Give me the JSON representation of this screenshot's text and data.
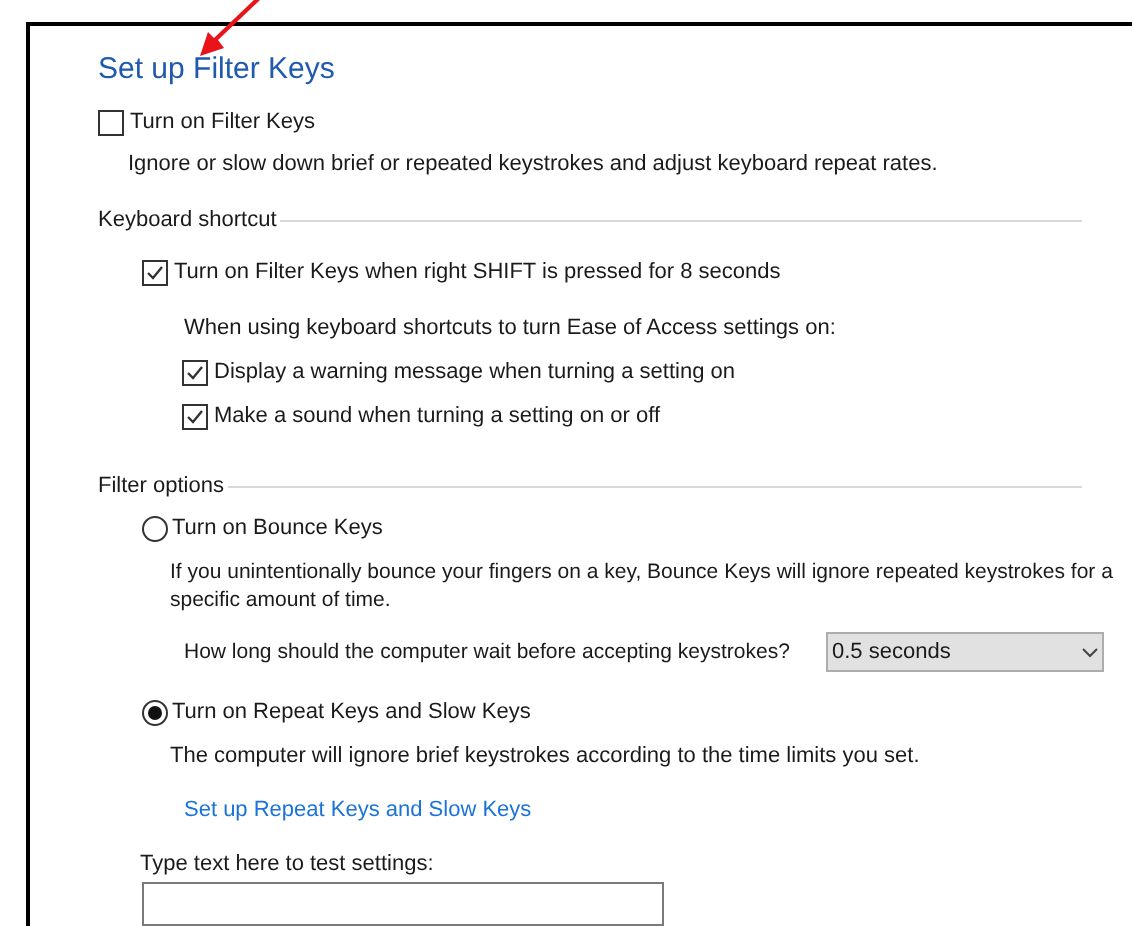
{
  "title": "Set up Filter Keys",
  "filter_keys": {
    "label": "Turn on Filter Keys",
    "checked": false,
    "description": "Ignore or slow down brief or repeated keystrokes and adjust keyboard repeat rates."
  },
  "keyboard_shortcut": {
    "heading": "Keyboard shortcut",
    "shortcut": {
      "label": "Turn on Filter Keys when right SHIFT is pressed for 8 seconds",
      "checked": true
    },
    "intro": "When using keyboard shortcuts to turn Ease of Access settings on:",
    "options": [
      {
        "label": "Display a warning message when turning a setting on",
        "checked": true
      },
      {
        "label": "Make a sound when turning a setting on or off",
        "checked": true
      }
    ]
  },
  "filter_options": {
    "heading": "Filter options",
    "bounce": {
      "label": "Turn on Bounce Keys",
      "selected": false,
      "description": "If you unintentionally bounce your fingers on a key, Bounce Keys will ignore repeated keystrokes for a specific amount of time.",
      "question": "How long should the computer wait before accepting keystrokes?",
      "dropdown_value": "0.5 seconds"
    },
    "repeat": {
      "label": "Turn on Repeat Keys and Slow Keys",
      "selected": true,
      "description": "The computer will ignore brief keystrokes according to the time limits you set.",
      "link": "Set up Repeat Keys and Slow Keys"
    }
  },
  "test": {
    "label": "Type text here to test settings:"
  }
}
